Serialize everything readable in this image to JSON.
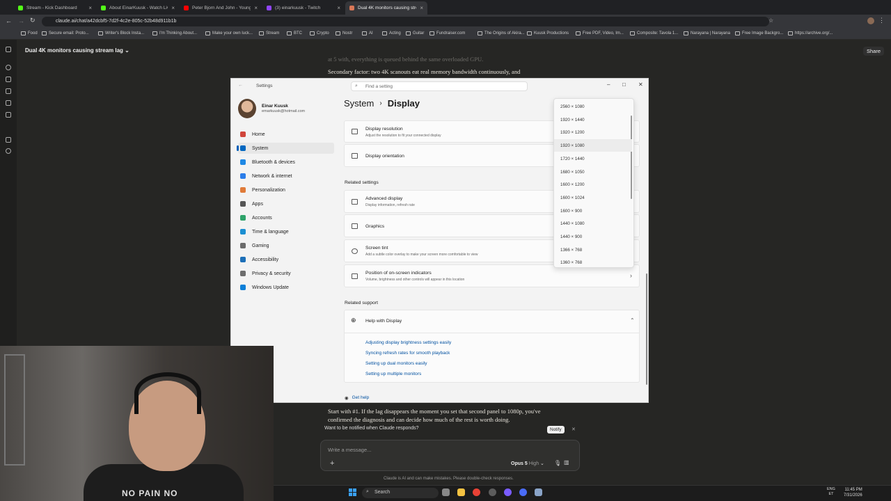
{
  "browser": {
    "tabs": [
      {
        "label": "Stream - Kick Dashboard",
        "color": "#53fc18"
      },
      {
        "label": "About EinarKuusk - Watch Live",
        "color": "#53fc18"
      },
      {
        "label": "Peter Bjorn And John - Young",
        "color": "#ff0000"
      },
      {
        "label": "(3) einarkuusk - Twitch",
        "color": "#9146ff"
      },
      {
        "label": "Dual 4K monitors causing strea",
        "color": "#d97757"
      }
    ],
    "url": "claude.ai/chat/a42dcbf5-7d2f-4c2e-805c-52b48d911b1b",
    "bookmarks": [
      "Food",
      "Secure email: Proto...",
      "Writer's Block Insta...",
      "I'm Thinking About...",
      "Make your own luck...",
      "Stream",
      "BTC",
      "Crypto",
      "Nostr",
      "AI",
      "Acting",
      "Guitar",
      "Fundraiser.com",
      "The Origins of Akira...",
      "Kuusk Productions",
      "Free PDF, Video, Im...",
      "Composite: Tavola 1...",
      "Narayana | Narayana",
      "Free Image Backgro...",
      "https://archive.org/..."
    ]
  },
  "chat": {
    "title": "Dual 4K monitors causing stream lag",
    "share_label": "Share",
    "line_top_partial": "at 5 with, everything is queued behind the same overloaded GPU.",
    "line_secondary": "Secondary factor: two 4K scanouts eat real memory bandwidth continuously, and",
    "line_start_1": "Start with #1. If the lag disappears the moment you set that second panel to 1080p, you've",
    "line_start_2": "confirmed the diagnosis and can decide how much of the rest is worth doing.",
    "notify_text": "Want to be notified when Claude responds?",
    "notify_button": "Notify",
    "composer_placeholder": "Write a message...",
    "model_name": "Opus 5",
    "model_effort": "High",
    "disclaimer": "Claude is AI and can make mistakes. Please double-check responses."
  },
  "settings": {
    "window_title": "Settings",
    "search_placeholder": "Find a setting",
    "user_name": "Einar Kuusk",
    "user_email": "emarkuusk@hotmail.com",
    "nav": [
      {
        "label": "Home",
        "color": "#d0453b"
      },
      {
        "label": "System",
        "color": "#0067c0"
      },
      {
        "label": "Bluetooth & devices",
        "color": "#1e88e5"
      },
      {
        "label": "Network & internet",
        "color": "#2b7de9"
      },
      {
        "label": "Personalization",
        "color": "#e07b39"
      },
      {
        "label": "Apps",
        "color": "#555555"
      },
      {
        "label": "Accounts",
        "color": "#2ea36a"
      },
      {
        "label": "Time & language",
        "color": "#1b8fd2"
      },
      {
        "label": "Gaming",
        "color": "#6b6b6b"
      },
      {
        "label": "Accessibility",
        "color": "#1d6fb8"
      },
      {
        "label": "Privacy & security",
        "color": "#6d6d6d"
      },
      {
        "label": "Windows Update",
        "color": "#0d7fd8"
      }
    ],
    "crumb_parent": "System",
    "crumb_current": "Display",
    "cards": {
      "resolution_title": "Display resolution",
      "resolution_sub": "Adjust the resolution to fit your connected display",
      "orientation_title": "Display orientation",
      "related_settings": "Related settings",
      "advanced_title": "Advanced display",
      "advanced_sub": "Display information, refresh rate",
      "graphics_title": "Graphics",
      "tint_title": "Screen tint",
      "tint_sub": "Add a subtle color overlay to make your screen more comfortable to view",
      "osd_title": "Position of on-screen indicators",
      "osd_sub": "Volume, brightness and other controls will appear in this location",
      "related_support": "Related support",
      "help_title": "Help with Display"
    },
    "help_links": [
      "Adjusting display brightness settings easily",
      "Syncing refresh rates for smooth playback",
      "Setting up dual monitors easily",
      "Setting up multiple monitors"
    ],
    "get_help": "Get help",
    "resolutions": [
      "2560 × 1080",
      "1920 × 1440",
      "1920 × 1200",
      "1920 × 1080",
      "1720 × 1440",
      "1680 × 1050",
      "1600 × 1200",
      "1600 × 1024",
      "1600 × 900",
      "1440 × 1080",
      "1440 × 900",
      "1366 × 768",
      "1360 × 768"
    ],
    "hovered_resolution": "1920 × 1080"
  },
  "webcam": {
    "shirt_text": "NO PAIN NO"
  },
  "taskbar": {
    "search": "Search",
    "lang_top": "ENG",
    "lang_bottom": "ET",
    "time": "11:45 PM",
    "date": "7/31/2026"
  }
}
